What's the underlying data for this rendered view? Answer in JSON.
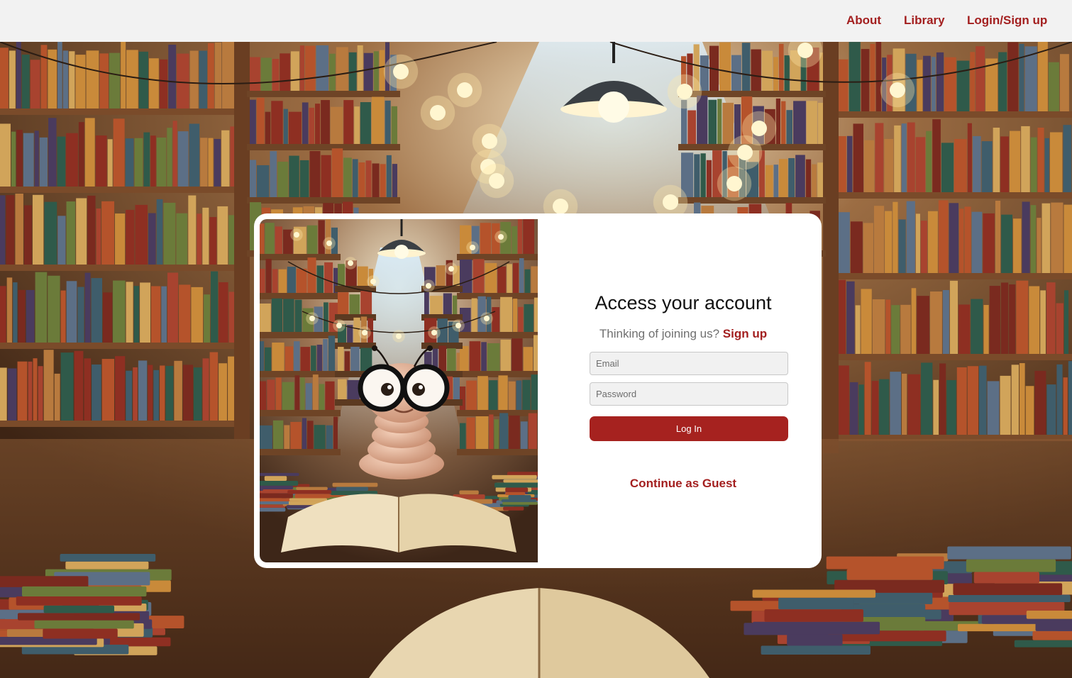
{
  "nav": {
    "items": [
      {
        "label": "About"
      },
      {
        "label": "Library"
      },
      {
        "label": "Login/Sign up"
      }
    ]
  },
  "form": {
    "title": "Access your account",
    "signup_prompt": "Thinking of joining us?",
    "signup_link": "Sign up",
    "email_placeholder": "Email",
    "password_placeholder": "Password",
    "login_label": "Log In",
    "guest_label": "Continue as Guest"
  },
  "colors": {
    "accent": "#a31f1f",
    "nav_background": "#f2f2f2",
    "card_background": "#ffffff"
  },
  "images": {
    "background": "library-bookshelves-scene",
    "illustration": "bookworm-with-glasses-reading-book"
  }
}
